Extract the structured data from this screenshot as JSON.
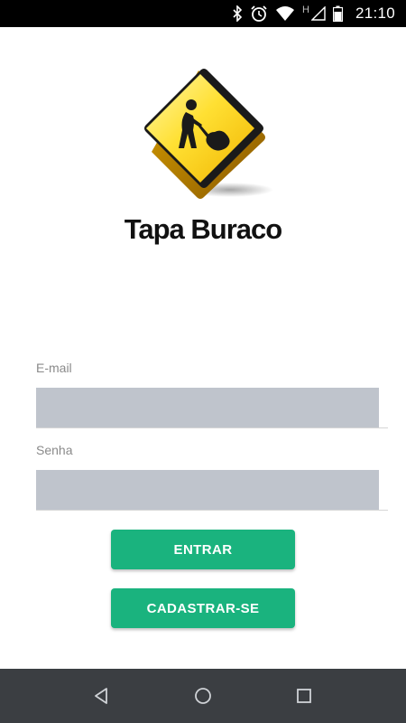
{
  "status_bar": {
    "time": "21:10",
    "network_letter": "H",
    "icons": [
      "bluetooth-icon",
      "alarm-icon",
      "wifi-icon",
      "cell-signal-icon",
      "battery-icon"
    ]
  },
  "app": {
    "title": "Tapa Buraco",
    "logo": "construction-sign-icon"
  },
  "form": {
    "email": {
      "label": "E-mail",
      "value": "",
      "placeholder": ""
    },
    "password": {
      "label": "Senha",
      "value": "",
      "placeholder": ""
    }
  },
  "buttons": {
    "login_label": "ENTRAR",
    "register_label": "CADASTRAR-SE"
  },
  "nav_bar": {
    "icons": [
      "back-icon",
      "home-icon",
      "recents-icon"
    ]
  },
  "colors": {
    "accent": "#1ab37e",
    "input_bg": "#bfc4cc",
    "nav_bar": "#3b3e42",
    "status_bar": "#000000"
  }
}
